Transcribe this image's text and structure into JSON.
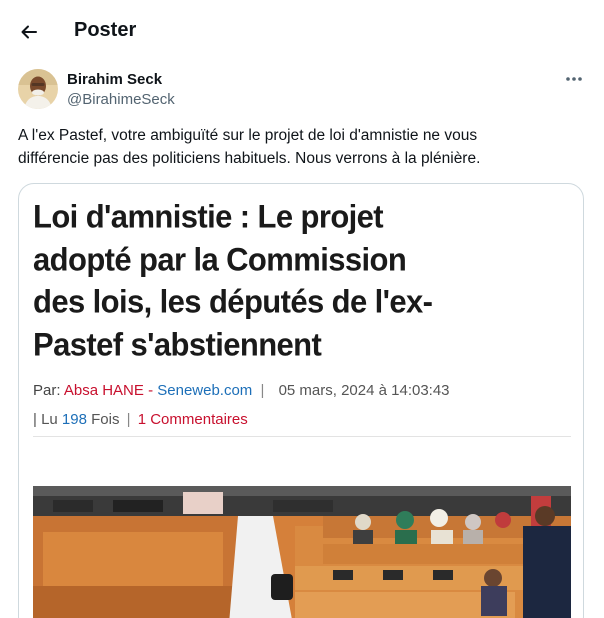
{
  "header": {
    "title": "Poster",
    "back_icon": "arrow-left-icon"
  },
  "tweet": {
    "author": {
      "name": "Birahim Seck",
      "handle": "@BirahimeSeck"
    },
    "more_icon": "more-horizontal-icon",
    "text_line1": "A l'ex Pastef, votre ambiguïté sur le projet de loi d'amnistie ne vous",
    "text_line2": "différencie pas des politiciens habituels. Nous verrons à la plénière."
  },
  "article": {
    "headline_line1": "Loi d'amnistie : Le projet",
    "headline_line2": "adopté par la Commission",
    "headline_line3": "des lois, les députés de l'ex-",
    "headline_line4": "Pastef s'abstiennent",
    "byline_label": "Par:",
    "author": "Absa HANE",
    "dash": "-",
    "source": "Seneweb.com",
    "separator": "|",
    "date": "05 mars, 2024 à 14:03:43",
    "stats_prefix": "| Lu",
    "reads": "198",
    "reads_suffix": "Fois",
    "comments": "1 Commentaires"
  },
  "colors": {
    "text_primary": "#0f1419",
    "text_secondary": "#536471",
    "border": "#cfd9de",
    "link_red": "#c8102e",
    "link_blue": "#1d6fb8"
  }
}
